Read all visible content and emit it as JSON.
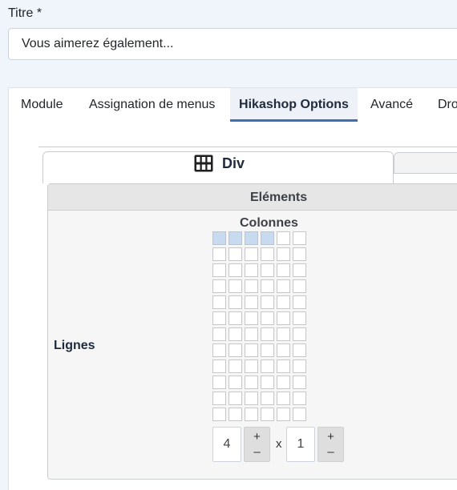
{
  "title_field": {
    "label": "Titre *",
    "value": "Vous aimerez également..."
  },
  "tabs": [
    {
      "label": "Module",
      "active": false
    },
    {
      "label": "Assignation de menus",
      "active": false
    },
    {
      "label": "Hikashop Options",
      "active": true
    },
    {
      "label": "Avancé",
      "active": false
    },
    {
      "label": "Dro",
      "active": false
    }
  ],
  "subtab": {
    "label": "Div",
    "icon": "div-layout-icon"
  },
  "elements_panel": {
    "header": "Eléments",
    "columns_label": "Colonnes",
    "rows_label": "Lignes",
    "grid": {
      "columns": 6,
      "rows": 12,
      "selected_columns": 4,
      "selected_rows": 1
    },
    "columns_value": "4",
    "rows_value": "1",
    "separator": "x",
    "stepper": {
      "plus": "+",
      "minus": "–"
    }
  },
  "colors": {
    "accent": "#3b6fb6",
    "selected_cell": "#c8daf0",
    "background": "#f0f4fb"
  }
}
